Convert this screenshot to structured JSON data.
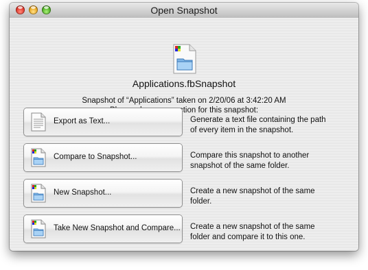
{
  "window": {
    "title": "Open Snapshot"
  },
  "header": {
    "filename": "Applications.fbSnapshot",
    "info_line1": "Snapshot of “Applications” taken on 2/20/06 at 3:42:20 AM",
    "info_line2": "Please choose an action for this snapshot:"
  },
  "actions": [
    {
      "label": "Export as Text...",
      "icon": "text-document-icon",
      "description_line1": "Generate a text file containing the path",
      "description_line2": "of every item in the snapshot."
    },
    {
      "label": "Compare to Snapshot...",
      "icon": "snapshot-document-icon",
      "description_line1": "Compare this snapshot to another",
      "description_line2": "snapshot of the same folder."
    },
    {
      "label": "New Snapshot...",
      "icon": "snapshot-document-icon",
      "description_line1": "Create a new snapshot of the same",
      "description_line2": "folder."
    },
    {
      "label": "Take New Snapshot and Compare...",
      "icon": "snapshot-document-icon",
      "description_line1": "Create a new snapshot of the same",
      "description_line2": "folder and compare it to this one."
    }
  ]
}
